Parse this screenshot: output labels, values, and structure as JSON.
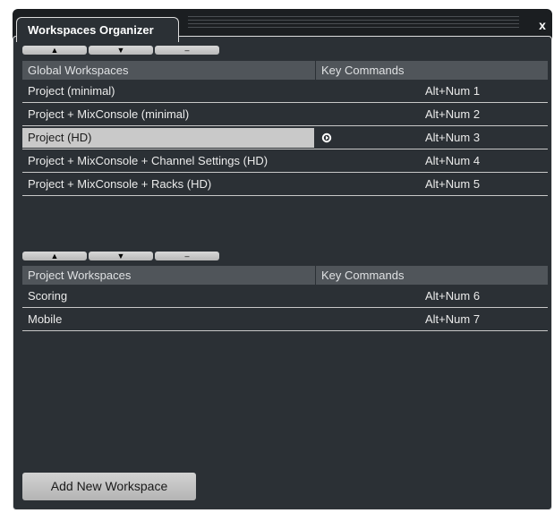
{
  "window": {
    "title": "Workspaces Organizer",
    "close_label": "x"
  },
  "global_section": {
    "buttons": [
      "▲",
      "▼",
      "–"
    ],
    "header": {
      "name_col": "Global Workspaces",
      "key_col": "Key Commands"
    },
    "rows": [
      {
        "name": "Project (minimal)",
        "key": "Alt+Num 1",
        "selected": false
      },
      {
        "name": "Project + MixConsole (minimal)",
        "key": "Alt+Num 2",
        "selected": false
      },
      {
        "name": "Project (HD)",
        "key": "Alt+Num 3",
        "selected": true,
        "active_icon": "active-workspace-icon"
      },
      {
        "name": "Project + MixConsole + Channel Settings (HD)",
        "key": "Alt+Num 4",
        "selected": false
      },
      {
        "name": "Project + MixConsole + Racks (HD)",
        "key": "Alt+Num 5",
        "selected": false
      }
    ]
  },
  "project_section": {
    "buttons": [
      "▲",
      "▼",
      "–"
    ],
    "header": {
      "name_col": "Project Workspaces",
      "key_col": "Key Commands"
    },
    "rows": [
      {
        "name": "Scoring",
        "key": "Alt+Num 6"
      },
      {
        "name": "Mobile",
        "key": "Alt+Num 7"
      }
    ]
  },
  "footer": {
    "add_button_label": "Add New Workspace"
  },
  "colors": {
    "panel_bg": "#2b3035",
    "header_bg": "#50555a",
    "selection_bg": "#c9c9c9",
    "button_bg": "#c8c8c8"
  }
}
